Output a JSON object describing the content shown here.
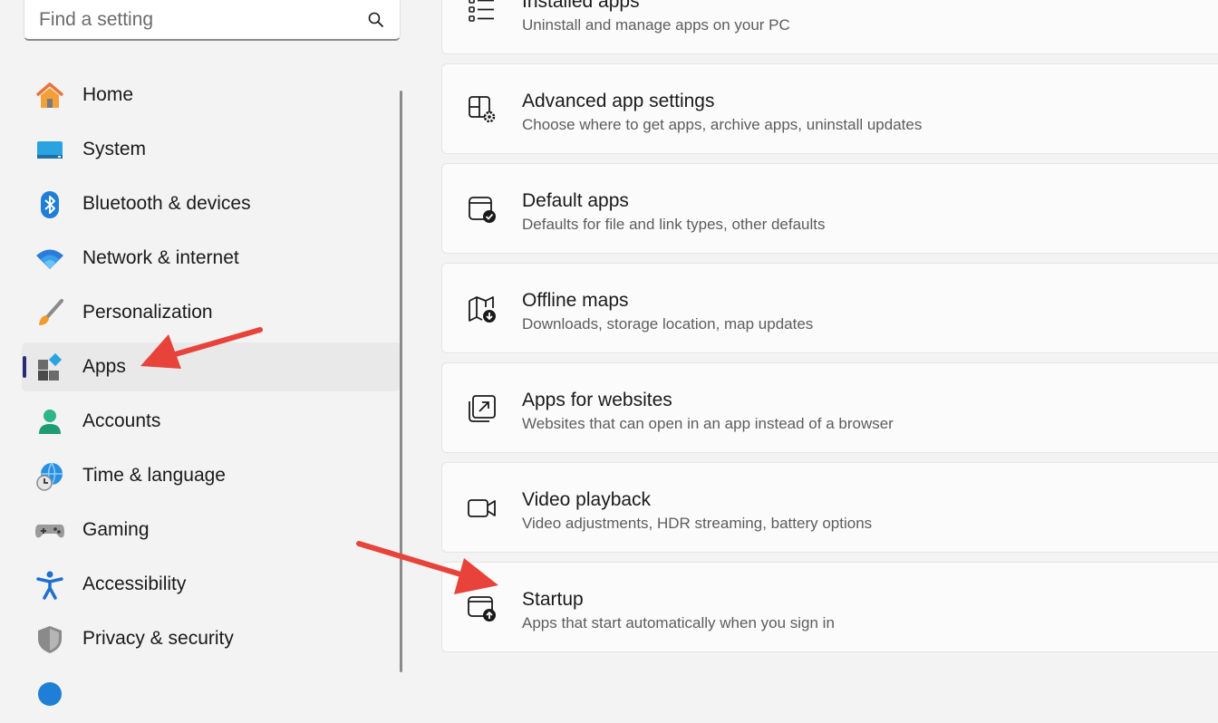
{
  "search": {
    "placeholder": "Find a setting",
    "icon": "search-icon"
  },
  "sidebar": {
    "selected_index": 5,
    "items": [
      {
        "label": "Home",
        "icon": "home-icon"
      },
      {
        "label": "System",
        "icon": "system-icon"
      },
      {
        "label": "Bluetooth & devices",
        "icon": "bluetooth-icon"
      },
      {
        "label": "Network & internet",
        "icon": "wifi-icon"
      },
      {
        "label": "Personalization",
        "icon": "brush-icon"
      },
      {
        "label": "Apps",
        "icon": "apps-icon"
      },
      {
        "label": "Accounts",
        "icon": "account-icon"
      },
      {
        "label": "Time & language",
        "icon": "globe-clock-icon"
      },
      {
        "label": "Gaming",
        "icon": "gamepad-icon"
      },
      {
        "label": "Accessibility",
        "icon": "accessibility-icon"
      },
      {
        "label": "Privacy & security",
        "icon": "shield-icon"
      }
    ]
  },
  "cards": [
    {
      "title": "Installed apps",
      "subtitle": "Uninstall and manage apps on your PC",
      "icon": "list-icon"
    },
    {
      "title": "Advanced app settings",
      "subtitle": "Choose where to get apps, archive apps, uninstall updates",
      "icon": "app-settings-icon"
    },
    {
      "title": "Default apps",
      "subtitle": "Defaults for file and link types, other defaults",
      "icon": "default-apps-icon"
    },
    {
      "title": "Offline maps",
      "subtitle": "Downloads, storage location, map updates",
      "icon": "map-download-icon"
    },
    {
      "title": "Apps for websites",
      "subtitle": "Websites that can open in an app instead of a browser",
      "icon": "open-external-icon"
    },
    {
      "title": "Video playback",
      "subtitle": "Video adjustments, HDR streaming, battery options",
      "icon": "video-camera-icon"
    },
    {
      "title": "Startup",
      "subtitle": "Apps that start automatically when you sign in",
      "icon": "startup-icon"
    }
  ],
  "colors": {
    "accent": "#2b2b74",
    "arrow": "#e8433a",
    "window_bg": "#f3f3f3",
    "card_bg": "#fbfbfb"
  }
}
